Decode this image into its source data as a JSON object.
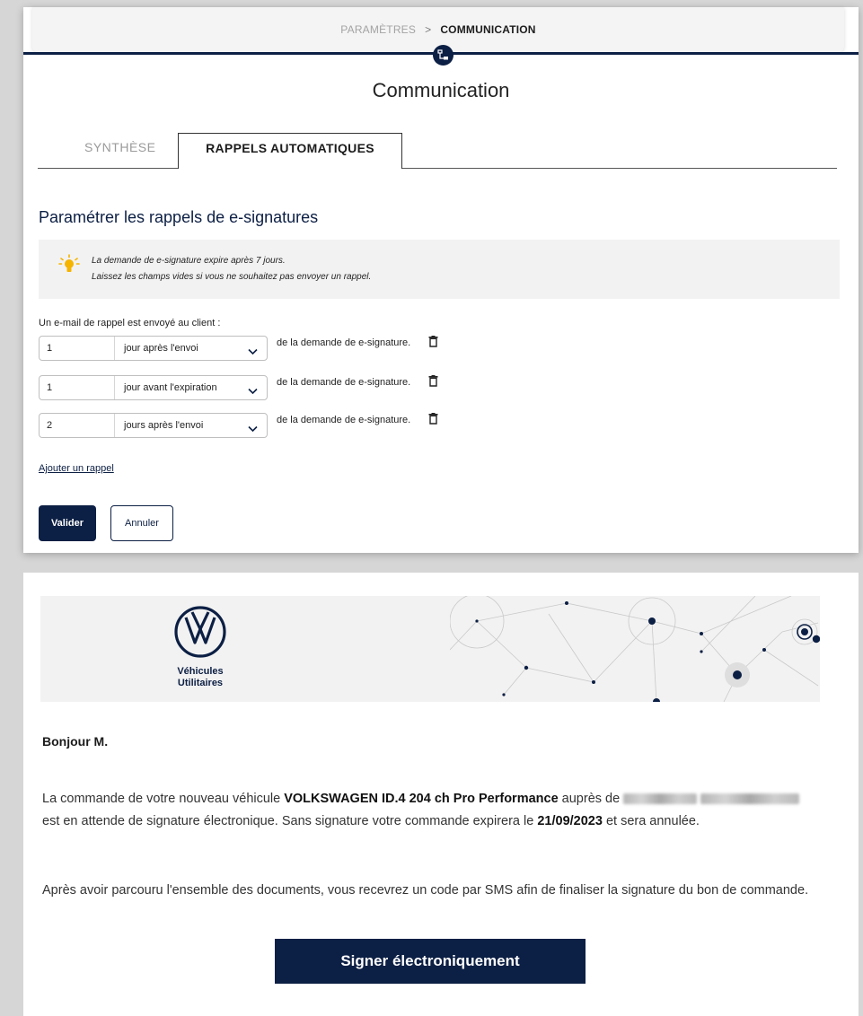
{
  "breadcrumb": {
    "parent": "PARAMÈTRES",
    "separator": ">",
    "current": "COMMUNICATION"
  },
  "page_title": "Communication",
  "tabs": [
    {
      "label": "SYNTHÈSE",
      "active": false
    },
    {
      "label": "RAPPELS AUTOMATIQUES",
      "active": true
    }
  ],
  "section_title": "Paramétrer les rappels de e-signatures",
  "info": {
    "line1": "La demande de e-signature expire après 7 jours.",
    "line2": "Laissez les champs vides si vous ne souhaitez pas envoyer un rappel."
  },
  "intro": "Un e-mail de rappel est envoyé au client :",
  "reminders": [
    {
      "value": "1",
      "unit": "jour après l'envoi",
      "suffix": "de la demande de e-signature."
    },
    {
      "value": "1",
      "unit": "jour avant l'expiration",
      "suffix": "de la demande de e-signature."
    },
    {
      "value": "2",
      "unit": "jours après l'envoi",
      "suffix": "de la demande de e-signature."
    }
  ],
  "add_link": "Ajouter un rappel",
  "buttons": {
    "validate": "Valider",
    "cancel": "Annuler"
  },
  "email": {
    "brand_line1": "Véhicules",
    "brand_line2": "Utilitaires",
    "greeting": "Bonjour M.",
    "p1_a": "La commande de votre nouveau véhicule ",
    "vehicle": "VOLKSWAGEN ID.4 204 ch Pro Performance",
    "p1_b": " auprès de ",
    "p1_c": " est en attende de signature électronique. Sans signature votre commande expirera le ",
    "date": "21/09/2023",
    "p1_d": " et sera annulée.",
    "p2": "Après avoir parcouru l'ensemble des documents, vous recevrez un code par SMS afin de finaliser la signature du bon de commande.",
    "sign_button": "Signer électroniquement"
  },
  "colors": {
    "navy": "#0c1f44",
    "info_bg": "#f2f2f2",
    "bulb": "#f5b400"
  }
}
